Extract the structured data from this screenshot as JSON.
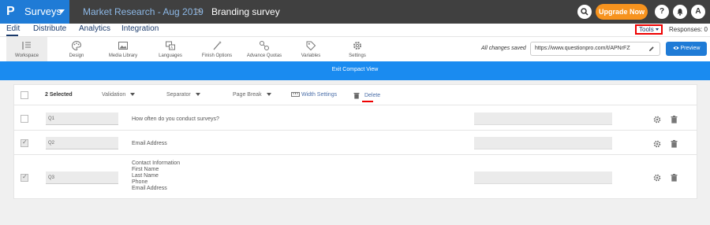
{
  "topbar": {
    "logo_letter": "P",
    "app_name": "Surveys",
    "crumb1": "Market Research - Aug 2019",
    "crumb_sep": ">",
    "crumb2": "Branding survey",
    "upgrade_label": "Upgrade Now",
    "help_label": "?",
    "avatar_label": "A"
  },
  "tabs": [
    {
      "label": "Edit",
      "active": true
    },
    {
      "label": "Distribute"
    },
    {
      "label": "Analytics"
    },
    {
      "label": "Integration"
    }
  ],
  "tools_label": "Tools",
  "responses_label": "Responses: 0",
  "toolbar": [
    {
      "label": "Workspace",
      "icon": "workspace-icon",
      "selected": true
    },
    {
      "label": "Design",
      "icon": "palette-icon"
    },
    {
      "label": "Media Library",
      "icon": "image-icon"
    },
    {
      "label": "Languages",
      "icon": "language-icon"
    },
    {
      "label": "Finish Options",
      "icon": "wand-icon"
    },
    {
      "label": "Advance Quotas",
      "icon": "quota-icon"
    },
    {
      "label": "Variables",
      "icon": "tag-icon"
    },
    {
      "label": "Settings",
      "icon": "gear-icon"
    }
  ],
  "saved_text": "All changes saved",
  "url_value": "https://www.questionpro.com/t/APNrFZ",
  "preview_label": "Preview",
  "banner_label": "Exit Compact View",
  "table_header": {
    "selected": "2 Selected",
    "validation": "Validation",
    "separator": "Separator",
    "page_break": "Page Break",
    "width_settings": "Width Settings",
    "delete": "Delete"
  },
  "rows": [
    {
      "num": "Q1",
      "text": "How often do you conduct surveys?",
      "checked": false
    },
    {
      "num": "Q2",
      "text": "Email Address",
      "checked": true
    },
    {
      "num": "Q3",
      "text": "Contact Information\nFirst Name\nLast Name\nPhone\nEmail Address",
      "checked": true
    }
  ],
  "colors": {
    "accent_blue": "#1f7bd6",
    "banner_blue": "#1a8bf0",
    "upgrade_orange": "#f7931e",
    "highlight_red": "#e00000"
  }
}
